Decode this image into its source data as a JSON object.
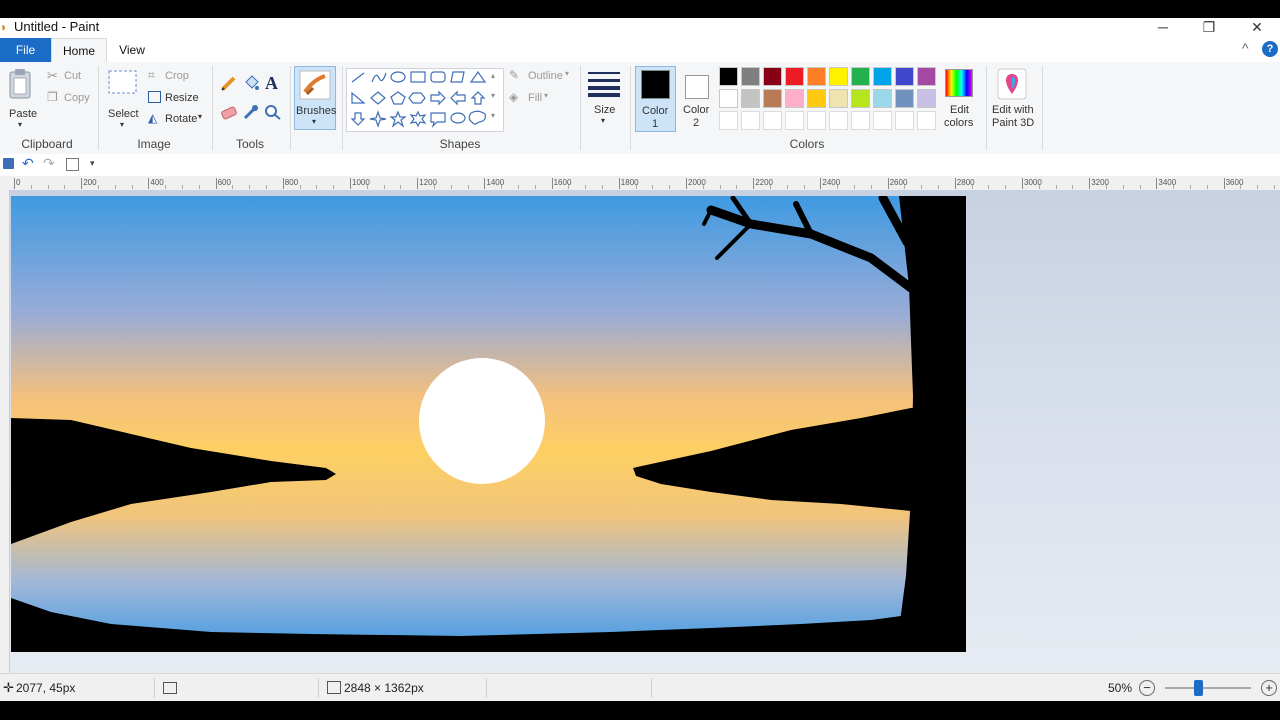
{
  "window": {
    "title": "Untitled - Paint",
    "minimize_glyph": "─",
    "restore_glyph": "❐",
    "close_glyph": "✕"
  },
  "tabs": [
    {
      "label": "File"
    },
    {
      "label": "Home"
    },
    {
      "label": "View"
    }
  ],
  "help_glyph": "?",
  "collapse_glyph": "^",
  "ribbon": {
    "clipboard": {
      "group_label": "Clipboard",
      "paste": "Paste",
      "cut": "Cut",
      "copy": "Copy"
    },
    "image": {
      "group_label": "Image",
      "select": "Select",
      "crop": "Crop",
      "resize": "Resize",
      "rotate": "Rotate"
    },
    "tools": {
      "group_label": "Tools",
      "text_glyph": "A"
    },
    "brushes": {
      "label": "Brushes"
    },
    "shapes": {
      "group_label": "Shapes",
      "outline": "Outline",
      "fill": "Fill"
    },
    "size": {
      "label": "Size"
    },
    "color1": {
      "label_line1": "Color",
      "label_line2": "1",
      "value": "#000000"
    },
    "color2": {
      "label_line1": "Color",
      "label_line2": "2",
      "value": "#ffffff"
    },
    "colors": {
      "group_label": "Colors",
      "row1": [
        "#000000",
        "#7f7f7f",
        "#880015",
        "#ed1c24",
        "#ff7f27",
        "#fff200",
        "#22b14c",
        "#00a2e8",
        "#3f48cc",
        "#a349a4"
      ],
      "row2": [
        "#ffffff",
        "#c3c3c3",
        "#b97a57",
        "#ffaec9",
        "#ffc90e",
        "#efe4b0",
        "#b5e61d",
        "#99d9ea",
        "#7092be",
        "#c8bfe7"
      ],
      "row3": [
        "#ffffff",
        "#ffffff",
        "#ffffff",
        "#ffffff",
        "#ffffff",
        "#ffffff",
        "#ffffff",
        "#ffffff",
        "#ffffff",
        "#ffffff"
      ]
    },
    "edit_colors": {
      "line1": "Edit",
      "line2": "colors"
    },
    "paint3d": {
      "line1": "Edit with",
      "line2": "Paint 3D"
    }
  },
  "ruler": {
    "labels": [
      "0",
      "200",
      "400",
      "600",
      "800",
      "1000",
      "1200",
      "1400",
      "1600",
      "1800",
      "2000",
      "2200",
      "2400",
      "2600",
      "2800",
      "3000",
      "3200",
      "3400",
      "3600"
    ]
  },
  "status": {
    "cursor_position": "2077, 45px",
    "image_size": "2848 × 1362px",
    "zoom": "50%",
    "zoom_out_glyph": "−",
    "zoom_in_glyph": "+",
    "zoom_slider_level": 0.5
  }
}
